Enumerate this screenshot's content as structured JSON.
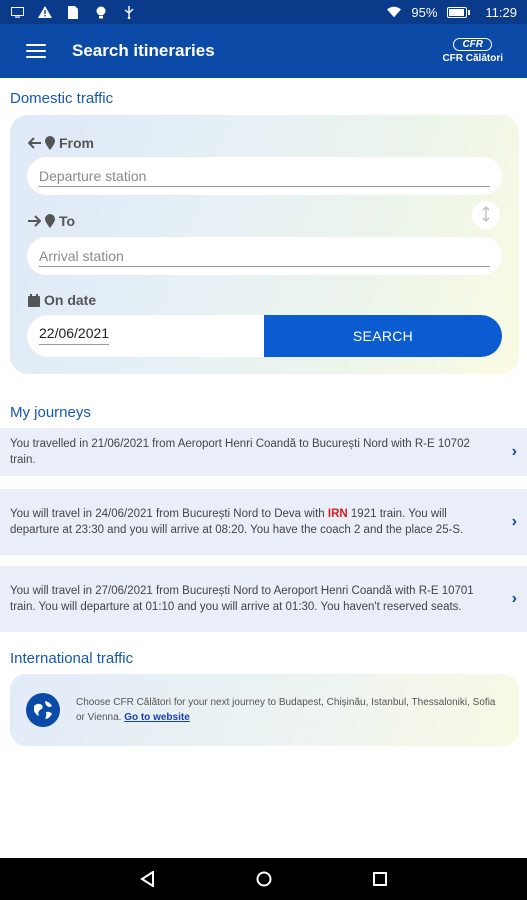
{
  "status_bar": {
    "battery": "95%",
    "time": "11:29",
    "battery_level": 0.95
  },
  "app_bar": {
    "title": "Search itineraries",
    "logo_mark": "CFR",
    "logo_brand": "CFR Călători"
  },
  "domestic": {
    "title": "Domestic traffic",
    "from_label": "From",
    "from_placeholder": "Departure station",
    "to_label": "To",
    "to_placeholder": "Arrival station",
    "date_label": "On date",
    "date_value": "22/06/2021",
    "search_label": "SEARCH"
  },
  "journeys": {
    "title": "My journeys",
    "items": [
      {
        "pre": "You travelled in 21/06/2021 from Aeroport Henri Coandă to București Nord with ",
        "brand": "R-E",
        "post": " 10702 train."
      },
      {
        "pre": "You will travel in 24/06/2021  from București Nord to Deva with ",
        "brand": "IRN",
        "post": " 1921 train. You will departure at 23:30 and you will arrive at 08:20. You have the coach 2 and the place 25-S."
      },
      {
        "pre": "You will travel in 27/06/2021  from București Nord to Aeroport Henri Coandă with ",
        "brand": "R-E",
        "post": " 10701 train. You will departure at 01:10 and you will arrive at 01:30. You haven't reserved seats."
      }
    ]
  },
  "international": {
    "title": "International traffic",
    "text": "Choose CFR Călători for your next journey to Budapest, Chișinău, Istanbul, Thessaloniki, Sofia or Vienna. ",
    "link": "Go to website"
  },
  "icons": {
    "menu": "menu-icon",
    "back_arrow": "arrow-left-icon",
    "forward_arrow": "arrow-right-icon",
    "pin": "location-pin-icon",
    "calendar": "calendar-icon",
    "swap": "swap-vertical-icon",
    "chevron": "chevron-right-icon",
    "globe": "globe-icon"
  },
  "colors": {
    "primary": "#0b4aa6",
    "button": "#0b5cd0",
    "accent_red": "#d62020",
    "journey_bg": "#e9eef8"
  }
}
